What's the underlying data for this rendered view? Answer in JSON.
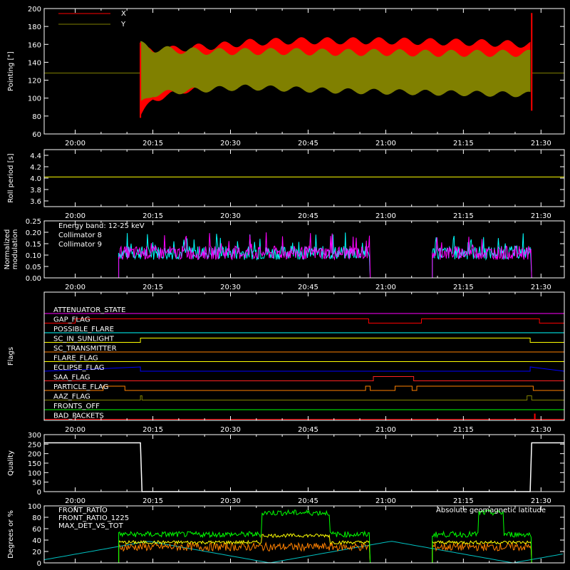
{
  "colors": {
    "background": "#000000",
    "axes": "#ffffff",
    "pointing_x": "#ff0000",
    "pointing_y": "#808000",
    "roll": "#ffff00",
    "coll8": "#00ffff",
    "coll9": "#ff00ff",
    "quality": "#ffffff",
    "front_ratio": "#ffff00",
    "front_ratio_1225": "#00ff00",
    "max_det": "#ff8000",
    "geomag": "#00c0c0"
  },
  "time_ticks": [
    "20:00",
    "20:15",
    "20:30",
    "20:45",
    "21:00",
    "21:15",
    "21:30"
  ],
  "chart_data": [
    {
      "type": "area",
      "ylabel": "Pointing [\"]",
      "ylim": [
        60,
        200
      ],
      "yticks": [
        "200",
        "180",
        "160",
        "140",
        "120",
        "100",
        "80",
        "60"
      ],
      "legend": [
        "X",
        "Y"
      ],
      "series": [
        {
          "name": "X",
          "t_min": [
            20.21,
            20.25,
            20.35,
            20.45,
            20.55,
            20.7,
            20.85,
            21.0,
            21.15,
            21.3,
            21.45
          ],
          "lower": [
            80,
            98,
            108,
            114,
            120,
            124,
            125,
            126,
            127,
            128,
            125
          ],
          "upper": [
            155,
            152,
            156,
            158,
            162,
            164,
            164,
            164,
            163,
            162,
            160
          ]
        },
        {
          "name": "Y",
          "t_min": [
            20.21,
            20.25,
            20.35,
            20.45,
            20.55,
            20.7,
            20.85,
            21.0,
            21.15,
            21.3,
            21.45
          ],
          "lower": [
            93,
            104,
            108,
            110,
            112,
            110,
            108,
            107,
            106,
            105,
            104
          ],
          "upper": [
            160,
            155,
            153,
            152,
            152,
            152,
            151,
            151,
            150,
            150,
            150
          ]
        }
      ]
    },
    {
      "type": "line",
      "ylabel": "Roll period [s]",
      "ylim": [
        3.5,
        4.5
      ],
      "yticks": [
        "4.4",
        "4.2",
        "4.0",
        "3.8",
        "3.6"
      ],
      "series": [
        {
          "name": "roll",
          "value": 4.02
        }
      ]
    },
    {
      "type": "line",
      "ylabel": "Normalized modulation",
      "ylim": [
        0,
        0.25
      ],
      "yticks": [
        "0.25",
        "0.20",
        "0.15",
        "0.10",
        "0.05",
        "0.00"
      ],
      "legend_title": "Energy band: 12-25 keV",
      "legend": [
        "Collimator 8",
        "Collimator 9"
      ],
      "segments": [
        [
          20.14,
          20.95
        ],
        [
          21.15,
          21.47
        ]
      ],
      "mean": 0.11
    },
    {
      "type": "table",
      "ylabel": "Flags",
      "flags": [
        "ATTENUATOR_STATE",
        "GAP_FLAG",
        "POSSIBLE_FLARE",
        "SC_IN_SUNLIGHT",
        "SC_TRANSMITTER",
        "FLARE_FLAG",
        "ECLIPSE_FLAG",
        "SAA_FLAG",
        "PARTICLE_FLAG",
        "AAZ_FLAG",
        "FRONTS_OFF",
        "BAD_PACKETS"
      ],
      "flag_colors": [
        "#ff00ff",
        "#ff0000",
        "#00ffff",
        "#ffff00",
        "#ff8000",
        "#ffff00",
        "#0000ff",
        "#ff2020",
        "#ff8000",
        "#808000",
        "#00ff00",
        "#ff0000"
      ]
    },
    {
      "type": "line",
      "ylabel": "Quality",
      "ylim": [
        0,
        300
      ],
      "yticks": [
        "300",
        "250",
        "200",
        "150",
        "100",
        "50",
        "0"
      ],
      "series": [
        {
          "name": "quality",
          "high": 257,
          "low": 0
        }
      ]
    },
    {
      "type": "line",
      "ylabel": "Degrees or %",
      "ylim": [
        0,
        100
      ],
      "yticks": [
        "100",
        "80",
        "60",
        "40",
        "20",
        "0"
      ],
      "legend": [
        "FRONT_RATIO",
        "FRONT_RATIO_1225",
        "MAX_DET_VS_TOT"
      ],
      "legend_right": "Absolute geomagnetic latitude",
      "series": [
        {
          "name": "FRONT_RATIO",
          "mean": 36
        },
        {
          "name": "FRONT_RATIO_1225",
          "mean": 50,
          "high_mean": 88
        },
        {
          "name": "MAX_DET_VS_TOT",
          "mean": 28
        }
      ]
    }
  ]
}
